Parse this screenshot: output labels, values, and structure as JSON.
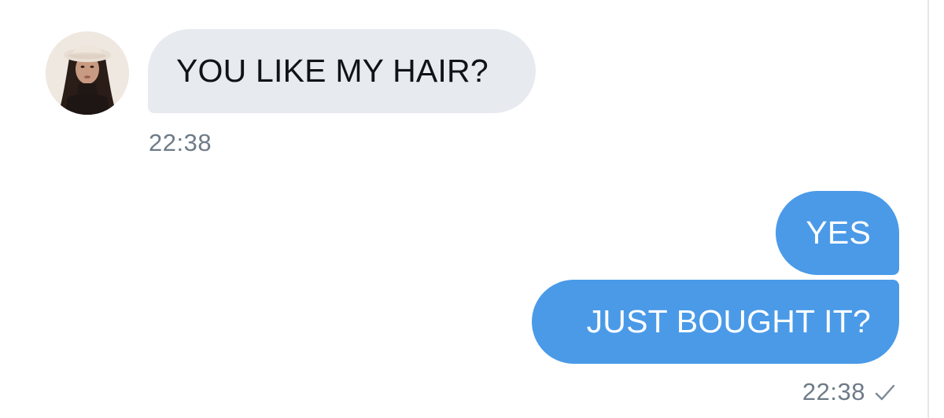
{
  "conversation": {
    "messages": [
      {
        "direction": "incoming",
        "text": "YOU LIKE MY HAIR?"
      },
      {
        "direction": "outgoing",
        "text": "YES"
      },
      {
        "direction": "outgoing",
        "text": "JUST BOUGHT IT?"
      }
    ],
    "incoming_time": "22:38",
    "outgoing_time": "22:38",
    "outgoing_status_icon": "check-icon"
  },
  "colors": {
    "incoming_bubble": "#e7eaef",
    "outgoing_bubble": "#4a9ae8",
    "timestamp": "#6e7b88"
  }
}
